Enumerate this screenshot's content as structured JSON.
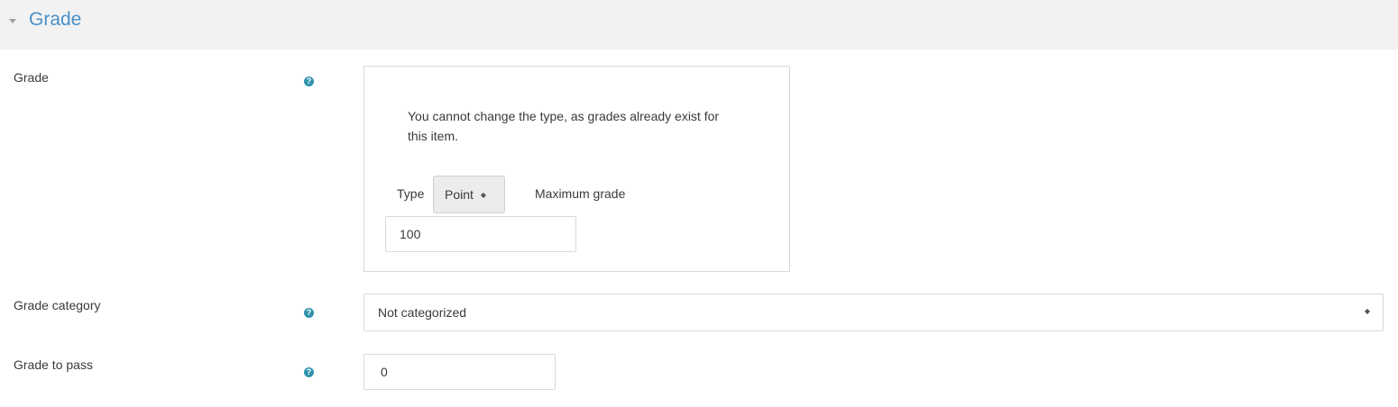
{
  "section": {
    "title": "Grade",
    "collapse_icon": "chevron-down-icon"
  },
  "grade": {
    "label": "Grade",
    "help_icon": "help-icon",
    "notice": "You cannot change the type, as grades already exist for this item.",
    "type_label": "Type",
    "type_value": "Point",
    "max_label": "Maximum grade",
    "max_value": "100"
  },
  "category": {
    "label": "Grade category",
    "help_icon": "help-icon",
    "value": "Not categorized"
  },
  "pass": {
    "label": "Grade to pass",
    "help_icon": "help-icon",
    "value": "0"
  },
  "colors": {
    "accent": "#4a90c8",
    "help_icon": "#2f93ab",
    "header_bg": "#f2f2f2"
  }
}
